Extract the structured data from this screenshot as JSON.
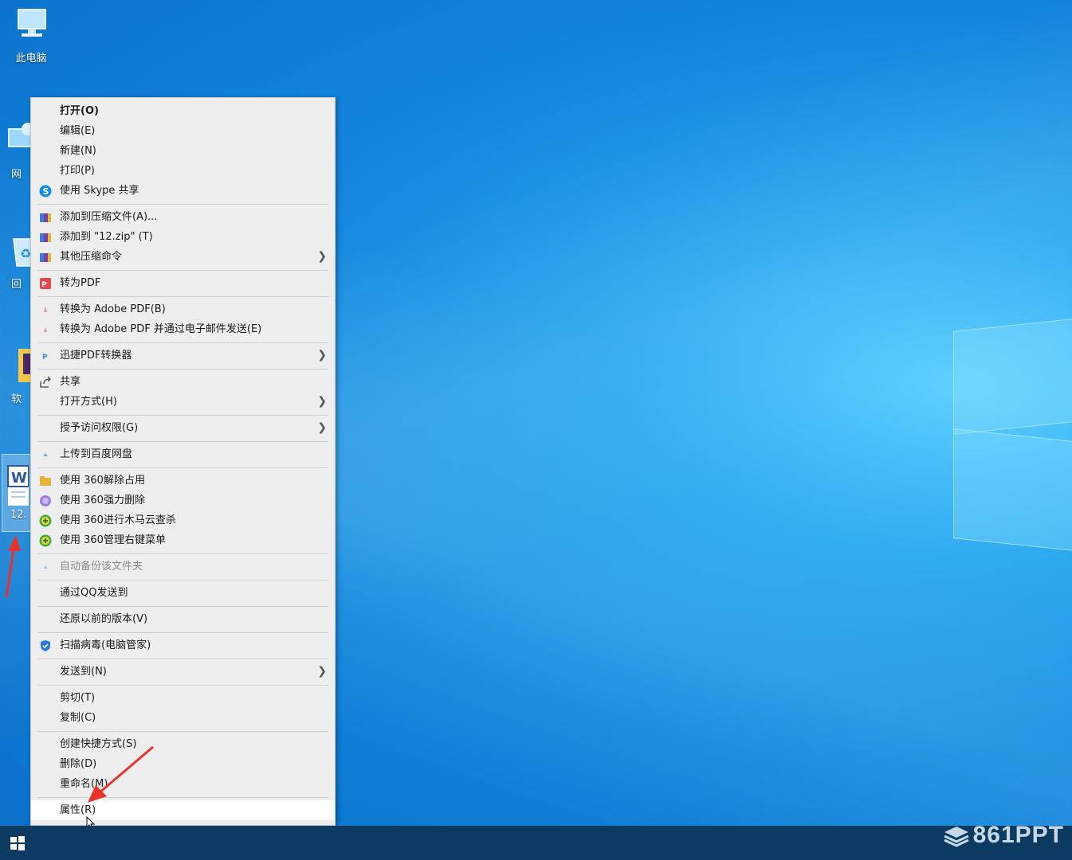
{
  "desktop": {
    "icons": [
      {
        "label": "此电脑"
      },
      {
        "label": "网"
      },
      {
        "label": "回"
      },
      {
        "label": "软"
      },
      {
        "label": "12."
      }
    ]
  },
  "context_menu": {
    "items": [
      {
        "label": "打开(O)"
      },
      {
        "label": "编辑(E)"
      },
      {
        "label": "新建(N)"
      },
      {
        "label": "打印(P)"
      },
      {
        "label": "使用 Skype 共享",
        "icon": "skype-icon"
      },
      {
        "label": "添加到压缩文件(A)...",
        "icon": "winrar-icon"
      },
      {
        "label": "添加到 \"12.zip\" (T)",
        "icon": "winrar-icon"
      },
      {
        "label": "其他压缩命令",
        "icon": "winrar-icon",
        "submenu": true
      },
      {
        "label": "转为PDF",
        "icon": "pdf-icon"
      },
      {
        "label": "转换为 Adobe PDF(B)",
        "icon": "adobe-pdf-icon"
      },
      {
        "label": "转换为 Adobe PDF 并通过电子邮件发送(E)",
        "icon": "adobe-pdf-icon"
      },
      {
        "label": "迅捷PDF转换器",
        "icon": "pdf-converter-icon",
        "submenu": true
      },
      {
        "label": "共享",
        "icon": "share-icon"
      },
      {
        "label": "打开方式(H)",
        "submenu": true
      },
      {
        "label": "授予访问权限(G)",
        "submenu": true
      },
      {
        "label": "上传到百度网盘",
        "icon": "baidu-cloud-icon"
      },
      {
        "label": "使用 360解除占用",
        "icon": "folder-360-icon"
      },
      {
        "label": "使用 360强力删除",
        "icon": "delete-360-icon"
      },
      {
        "label": "使用 360进行木马云查杀",
        "icon": "scan-360-icon"
      },
      {
        "label": "使用 360管理右键菜单",
        "icon": "scan-360-icon"
      },
      {
        "label": "自动备份该文件夹",
        "icon": "cloud-icon"
      },
      {
        "label": "通过QQ发送到"
      },
      {
        "label": "还原以前的版本(V)"
      },
      {
        "label": "扫描病毒(电脑管家)",
        "icon": "shield-icon"
      },
      {
        "label": "发送到(N)",
        "submenu": true
      },
      {
        "label": "剪切(T)"
      },
      {
        "label": "复制(C)"
      },
      {
        "label": "创建快捷方式(S)"
      },
      {
        "label": "删除(D)"
      },
      {
        "label": "重命名(M)"
      },
      {
        "label": "属性(R)"
      }
    ]
  },
  "watermark": {
    "text": "861PPT"
  },
  "colors": {
    "accent_arrow": "#e8332c",
    "taskbar": "#0c3a60",
    "menu_bg": "#eeeeee"
  }
}
